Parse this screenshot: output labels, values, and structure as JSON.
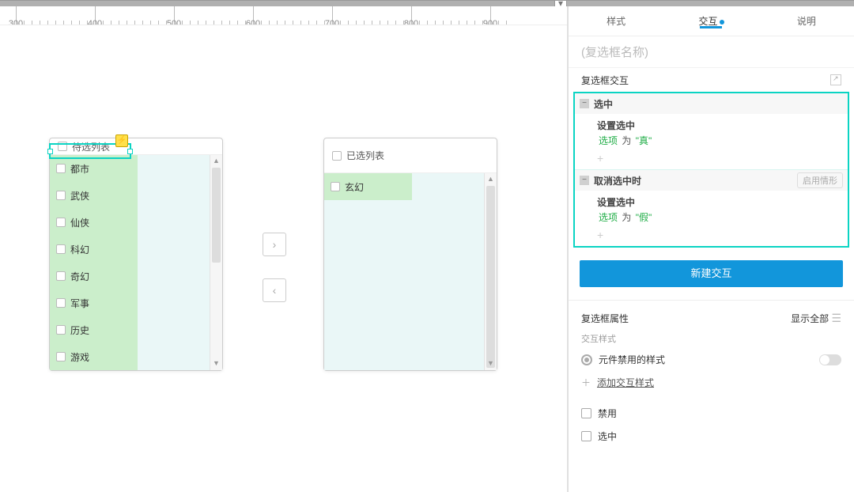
{
  "ruler": {
    "marks": [
      400,
      500,
      600,
      700,
      800,
      900
    ]
  },
  "canvas": {
    "pending_panel": {
      "title": "待选列表",
      "items": [
        "都市",
        "武侠",
        "仙侠",
        "科幻",
        "奇幻",
        "军事",
        "历史",
        "游戏"
      ]
    },
    "selected_panel": {
      "title": "已选列表",
      "items": [
        "玄幻"
      ]
    }
  },
  "sidebar": {
    "tabs": {
      "style": "样式",
      "interact": "交互",
      "notes": "说明"
    },
    "name_placeholder": "(复选框名称)",
    "ix_header": "复选框交互",
    "events": [
      {
        "name": "选中",
        "action": "设置选中",
        "target": "选项",
        "conj": "为",
        "value": "\"真\"",
        "enable_case": ""
      },
      {
        "name": "取消选中时",
        "action": "设置选中",
        "target": "选项",
        "conj": "为",
        "value": "\"假\"",
        "enable_case": "启用情形"
      }
    ],
    "new_btn": "新建交互",
    "props_header": "复选框属性",
    "show_all": "显示全部",
    "ix_style_header": "交互样式",
    "disabled_style": "元件禁用的样式",
    "add_ix_style": "添加交互样式",
    "disable_label": "禁用",
    "selected_label": "选中"
  }
}
